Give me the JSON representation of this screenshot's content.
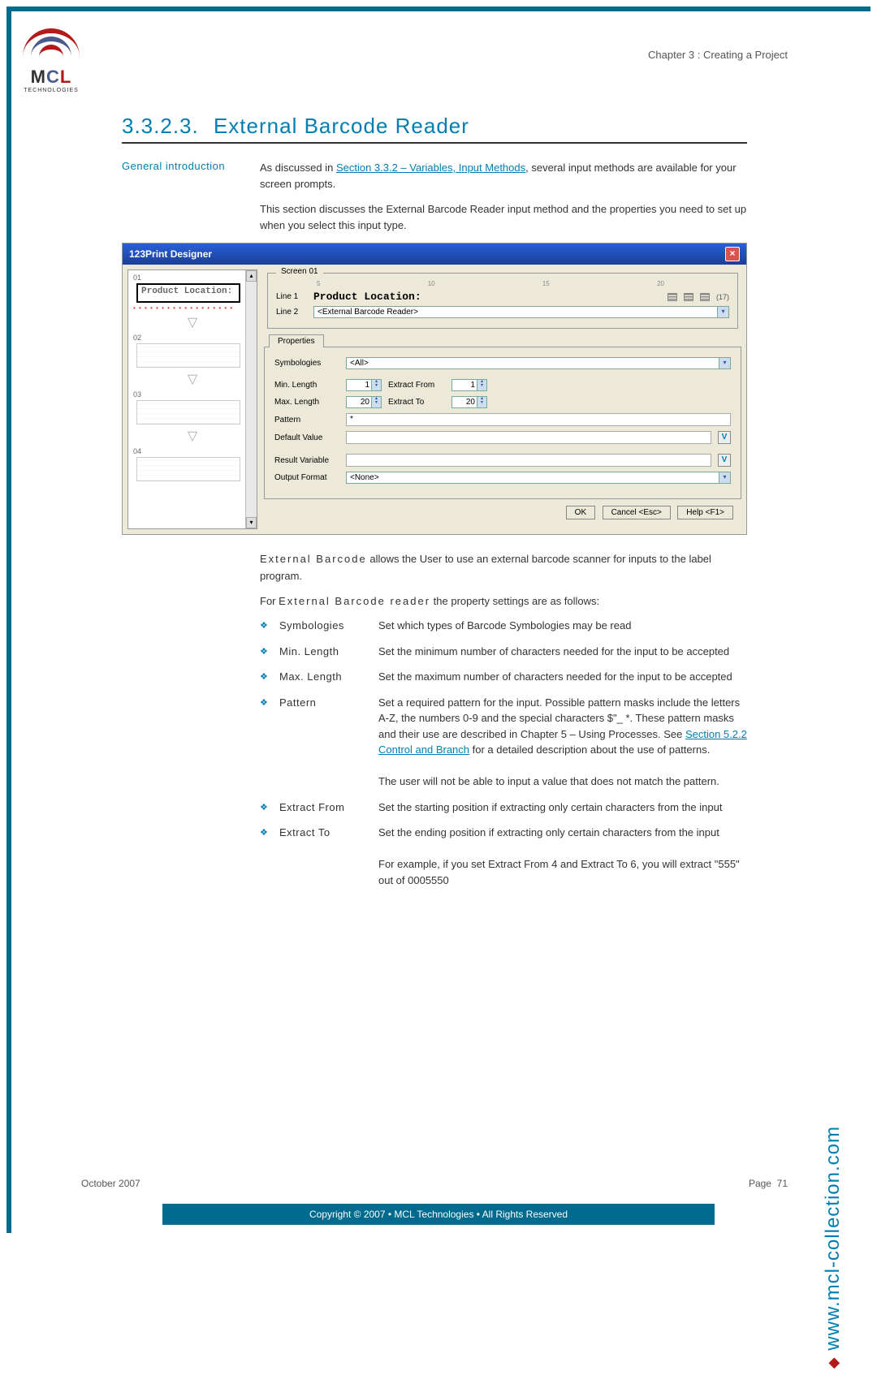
{
  "header": {
    "chapter": "Chapter 3 : Creating a Project"
  },
  "logo": {
    "brand1": "M",
    "brand2": "C",
    "brand3": "L",
    "sub": "TECHNOLOGIES"
  },
  "section": {
    "number": "3.3.2.3.",
    "title": "External Barcode Reader"
  },
  "intro": {
    "label": "General introduction",
    "p1_pre": "As discussed in ",
    "p1_link": "Section 3.3.2 – Variables, Input Methods",
    "p1_post": ", several input methods are available for your screen prompts.",
    "p2": "This section discusses the External Barcode Reader input method and the properties you need to set up when you select this input type."
  },
  "screenshot": {
    "title": "123Print Designer",
    "left": {
      "s1_num": "01",
      "s1_text": "Product Location:",
      "s2_num": "02",
      "s3_num": "03",
      "s4_num": "04"
    },
    "right": {
      "legend": "Screen 01",
      "ruler": {
        "r5": "5",
        "r10": "10",
        "r15": "15",
        "r20": "20"
      },
      "line1_lbl": "Line 1",
      "line1_txt": "Product Location:",
      "line1_len": "(17)",
      "line2_lbl": "Line 2",
      "line2_val": "<External Barcode Reader>",
      "tab": "Properties",
      "symb_lbl": "Symbologies",
      "symb_val": "<All>",
      "minlen_lbl": "Min. Length",
      "minlen_val": "1",
      "maxlen_lbl": "Max. Length",
      "maxlen_val": "20",
      "extfrom_lbl": "Extract From",
      "extfrom_val": "1",
      "extto_lbl": "Extract To",
      "extto_val": "20",
      "pattern_lbl": "Pattern",
      "pattern_val": "*",
      "defval_lbl": "Default Value",
      "resvar_lbl": "Result Variable",
      "outfmt_lbl": "Output Format",
      "outfmt_val": "<None>",
      "ok": "OK",
      "cancel": "Cancel <Esc>",
      "help": "Help <F1>"
    }
  },
  "body": {
    "p1_strong": "External Barcode",
    "p1_rest": " allows the User to use an external barcode scanner for inputs to the label program.",
    "p2_pre": "For ",
    "p2_strong": "External Barcode reader",
    "p2_post": " the property settings are as follows:"
  },
  "props": {
    "symbologies": {
      "term": "Symbologies",
      "desc": "Set which types of Barcode Symbologies may be read"
    },
    "minlength": {
      "term": "Min. Length",
      "desc": "Set the minimum number of characters needed for the input to be accepted"
    },
    "maxlength": {
      "term": "Max. Length",
      "desc": "Set the maximum number of characters needed for the input to be accepted"
    },
    "pattern": {
      "term": "Pattern",
      "d1_pre": "Set a required pattern for the input.  Possible pattern masks include the letters A-Z, the numbers 0-9 and the special characters $\"_ *. These pattern masks and their use are described in Chapter 5 – Using Processes. See ",
      "d1_link": "Section 5.2.2 Control and Branch",
      "d1_post": " for a detailed description about the use of patterns.",
      "d2": "The user will not be able to input a value that does not match the pattern."
    },
    "extfrom": {
      "term": "Extract From",
      "desc": "Set the starting position if extracting only certain characters from the input"
    },
    "extto": {
      "term": "Extract To",
      "d1": "Set the ending position if extracting only certain characters from the input",
      "d2": "For example, if you set Extract From 4 and Extract To 6, you will extract \"555\" out of 0005550"
    }
  },
  "side_url": "www.mcl-collection.com",
  "footer": {
    "date": "October 2007",
    "page_lbl": "Page",
    "page_num": "71"
  },
  "copyright": "Copyright © 2007 • MCL Technologies • All Rights Reserved"
}
